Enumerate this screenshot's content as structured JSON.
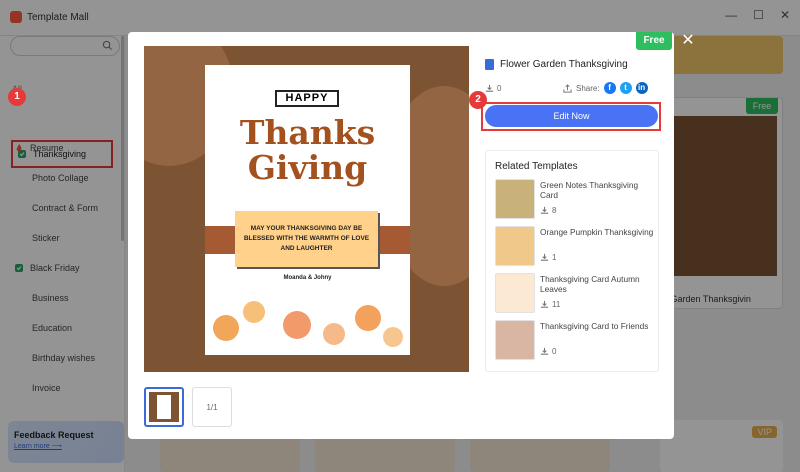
{
  "app": {
    "title": "Template Mall"
  },
  "sidebar": {
    "search_placeholder": "",
    "section_head": "All",
    "items": [
      {
        "label": "Thanksgiving"
      },
      {
        "label": "Resume"
      },
      {
        "label": "Photo Collage"
      },
      {
        "label": "Contract & Form"
      },
      {
        "label": "Sticker"
      },
      {
        "label": "Black Friday"
      },
      {
        "label": "Business"
      },
      {
        "label": "Education"
      },
      {
        "label": "Birthday wishes"
      },
      {
        "label": "Invoice"
      }
    ]
  },
  "feedback": {
    "title": "Feedback Request",
    "link": "Learn more ⟶"
  },
  "background": {
    "card_name": "r Garden Thanksgivin",
    "free_badge": "Free",
    "vip_badge": "VIP"
  },
  "modal": {
    "free_badge": "Free",
    "close_label": "✕",
    "template_title": "Flower Garden Thanksgiving",
    "download_count": "0",
    "share_label": "Share:",
    "edit_label": "Edit Now",
    "page_indicator": "1/1",
    "card": {
      "happy": "HAPPY",
      "thanks": "Thanks",
      "giving": "Giving",
      "message": "MAY YOUR THANKSGIVING DAY BE BLESSED WITH THE WARMTH OF LOVE AND LAUGHTER",
      "names": "Moanda & Johny"
    },
    "related_title": "Related Templates",
    "related": [
      {
        "name": "Green Notes Thanksgiving Card",
        "downloads": "8"
      },
      {
        "name": "Orange Pumpkin Thanksgiving",
        "downloads": "1"
      },
      {
        "name": "Thanksgiving Card Autumn Leaves",
        "downloads": "11"
      },
      {
        "name": "Thanksgiving Card to Friends",
        "downloads": "0"
      }
    ]
  },
  "callouts": {
    "one": "1",
    "two": "2"
  },
  "colors": {
    "accent": "#4a72f5",
    "free": "#2dbe60",
    "highlight": "#e63a3a"
  }
}
